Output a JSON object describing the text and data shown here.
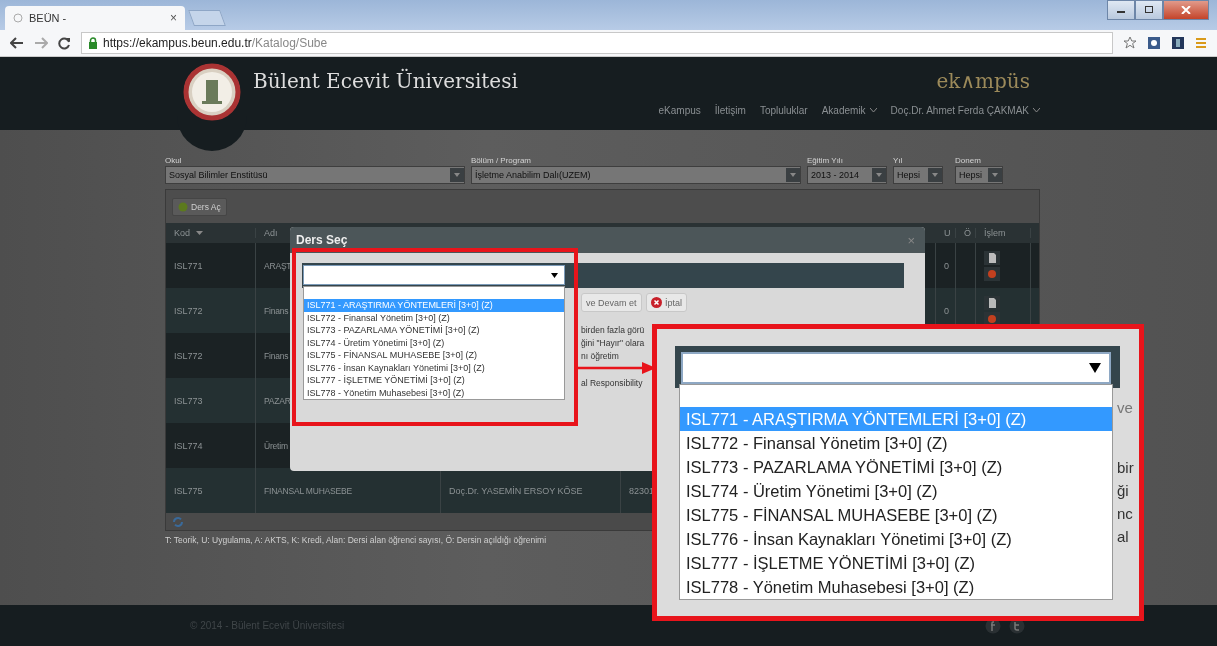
{
  "browser": {
    "tab_title": "BEÜN -",
    "tab_close": "×",
    "url_host": "https://ekampus.beun.edu.tr",
    "url_path": "/Katalog/Sube"
  },
  "header": {
    "title": "Bülent Ecevit Üniversitesi",
    "brand": "ek∧mpüs",
    "nav": [
      {
        "label": "eKampus",
        "dropdown": false
      },
      {
        "label": "İletişim",
        "dropdown": false
      },
      {
        "label": "Topluluklar",
        "dropdown": false
      },
      {
        "label": "Akademik",
        "dropdown": true
      },
      {
        "label": "Doç.Dr. Ahmet Ferda ÇAKMAK",
        "dropdown": true
      }
    ]
  },
  "filters": [
    {
      "label": "Okul",
      "value": "Sosyal Bilimler Enstitüsü"
    },
    {
      "label": "Bölüm / Program",
      "value": "İşletme Anabilim Dalı(UZEM)"
    },
    {
      "label": "Eğitim Yılı",
      "value": "2013 - 2014"
    },
    {
      "label": "Yıl",
      "value": "Hepsi"
    },
    {
      "label": "Donem",
      "value": "Hepsi"
    }
  ],
  "grid": {
    "add_button": "Ders Aç",
    "columns_left": [
      {
        "label": "Kod",
        "sorted": true
      },
      {
        "label": "Adı",
        "sorted": false
      }
    ],
    "columns_right": [
      {
        "label": "U"
      },
      {
        "label": "Ö"
      },
      {
        "label": "İşlem"
      }
    ],
    "rows": [
      {
        "code": "ISL771",
        "name": "ARAŞT",
        "u": "0",
        "actions": true
      },
      {
        "code": "ISL772",
        "name": "Finans",
        "u": "0",
        "actions": true
      },
      {
        "code": "ISL772",
        "name": "Finans",
        "actions": false
      },
      {
        "code": "ISL773",
        "name": "PAZAR",
        "actions": false
      },
      {
        "code": "ISL774",
        "name": "Üretim",
        "actions": false
      },
      {
        "code": "ISL775",
        "name": "FINANSAL MUHASEBE",
        "instructor": "Doç.Dr. YASEMİN ERSOY KÖSE",
        "column_4": "82301",
        "actions": false
      }
    ],
    "legend": "T: Teorik, U: Uygulama, A: AKTS, K: Kredi, Alan: Dersi alan öğrenci sayısı, Ö: Dersin açıldığı öğrenimi"
  },
  "dialog": {
    "title": "Ders Seç",
    "close": "×",
    "continue_button": "ve Devam et",
    "cancel_button": "İptal",
    "notes": [
      "birden fazla görü",
      "ğini \"Hayır\" olara",
      "nı öğretim",
      "al Responsibility"
    ],
    "options": [
      {
        "label": "ISL771 - ARAŞTIRMA YÖNTEMLERİ [3+0] (Z)",
        "selected": true
      },
      {
        "label": "ISL772 - Finansal Yönetim [3+0] (Z)",
        "selected": false
      },
      {
        "label": "ISL773 - PAZARLAMA YÖNETİMİ [3+0] (Z)",
        "selected": false
      },
      {
        "label": "ISL774 - Üretim Yönetimi [3+0] (Z)",
        "selected": false
      },
      {
        "label": "ISL775 - FİNANSAL MUHASEBE [3+0] (Z)",
        "selected": false
      },
      {
        "label": "ISL776 - İnsan Kaynakları Yönetimi [3+0] (Z)",
        "selected": false
      },
      {
        "label": "ISL777 - İŞLETME YÖNETİMİ [3+0] (Z)",
        "selected": false
      },
      {
        "label": "ISL778 - Yönetim Muhasebesi [3+0] (Z)",
        "selected": false
      }
    ]
  },
  "callout": {
    "fragments": [
      "ve",
      "bir",
      "ği",
      "nc",
      "al"
    ],
    "options": [
      {
        "label": "ISL771 - ARAŞTIRMA YÖNTEMLERİ [3+0] (Z)",
        "selected": true
      },
      {
        "label": "ISL772 - Finansal Yönetim [3+0] (Z)",
        "selected": false
      },
      {
        "label": "ISL773 - PAZARLAMA YÖNETİMİ [3+0] (Z)",
        "selected": false
      },
      {
        "label": "ISL774 - Üretim Yönetimi [3+0] (Z)",
        "selected": false
      },
      {
        "label": "ISL775 - FİNANSAL MUHASEBE [3+0] (Z)",
        "selected": false
      },
      {
        "label": "ISL776 - İnsan Kaynakları Yönetimi [3+0] (Z)",
        "selected": false
      },
      {
        "label": "ISL777 - İŞLETME YÖNETİMİ [3+0] (Z)",
        "selected": false
      },
      {
        "label": "ISL778 - Yönetim Muhasebesi [3+0] (Z)",
        "selected": false
      }
    ]
  },
  "footer": {
    "copyright": "© 2014 - Bülent Ecevit Üniversitesi"
  }
}
